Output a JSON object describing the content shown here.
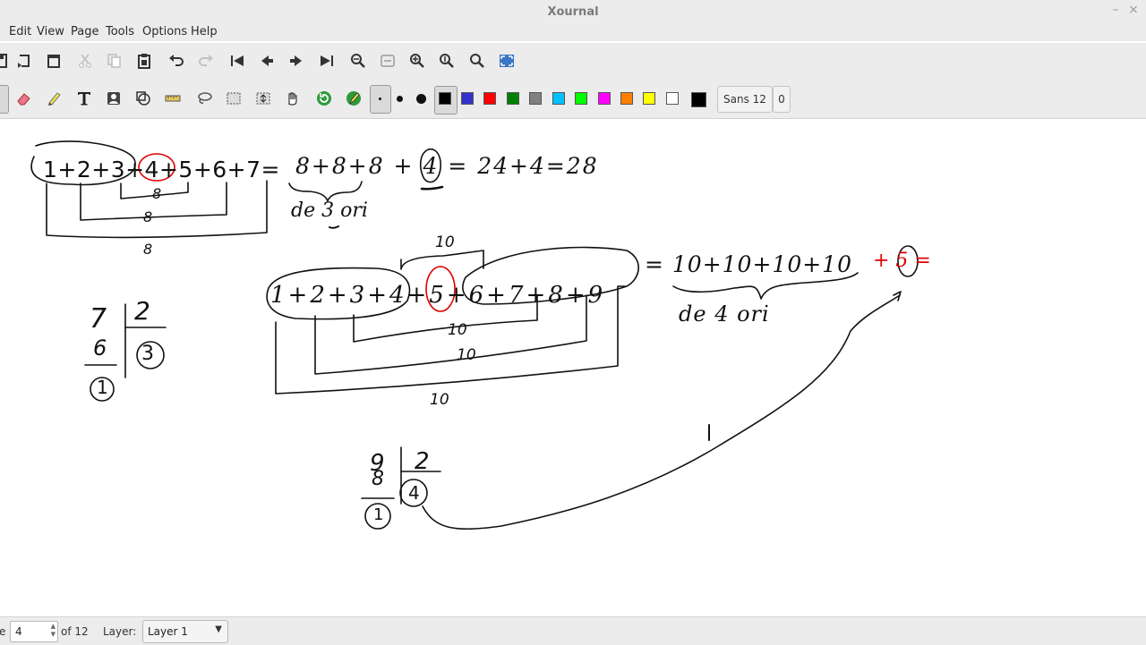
{
  "window": {
    "title": "Xournal",
    "minimize_label": "–",
    "close_label": "×"
  },
  "menubar": {
    "items": [
      "Edit",
      "View",
      "Page",
      "Tools",
      "Options",
      "Help"
    ]
  },
  "toolbar1": {
    "icons": [
      "save-icon",
      "new-page-icon",
      "delete-page-icon",
      "cut-icon",
      "copy-icon",
      "paste-icon",
      "undo-icon",
      "redo-icon",
      "first-page-icon",
      "previous-page-icon",
      "next-page-icon",
      "last-page-icon",
      "zoom-out-icon",
      "page-width-icon",
      "zoom-in-icon",
      "normal-size-icon",
      "zoom-set-icon",
      "fullscreen-icon"
    ]
  },
  "toolbar2": {
    "tools": [
      "pen-icon",
      "eraser-icon",
      "highlighter-icon",
      "text-icon",
      "image-icon",
      "shape-recognizer-icon",
      "ruler-icon",
      "lasso-select-icon",
      "rect-select-icon",
      "vertical-space-icon",
      "hand-icon",
      "default-tool-icon",
      "default-pen-icon"
    ],
    "thickness": [
      "fine",
      "medium",
      "thick"
    ],
    "colors": [
      "#000000",
      "#3333cc",
      "#ff0000",
      "#008000",
      "#808080",
      "#00c0ff",
      "#00ff00",
      "#ff00ff",
      "#ff8000",
      "#ffff00",
      "#ffffff"
    ],
    "selected_color": "#000000",
    "current_color": "#000000",
    "font_label": "Sans 12",
    "font_value": "0"
  },
  "canvas": {
    "notes": {
      "eq1": "1+2+3+4+5+6+7=",
      "eq1_rhs": "8+8+8 + 4 = 24+4=28",
      "de3ori": "de 3 ori",
      "eq2": "1+2+3+4+5+6+7+8+9",
      "eq2_rhs": "= 10+10+10+10",
      "eq2_red": "+ 5 =",
      "de4ori": "de 4 ori",
      "div1": "7 | 2",
      "div2": "9 | 2"
    }
  },
  "statusbar": {
    "page_prefix": "e",
    "page_value": "4",
    "page_of": "of 12",
    "layer_label": "Layer:",
    "layer_value": "Layer 1"
  }
}
